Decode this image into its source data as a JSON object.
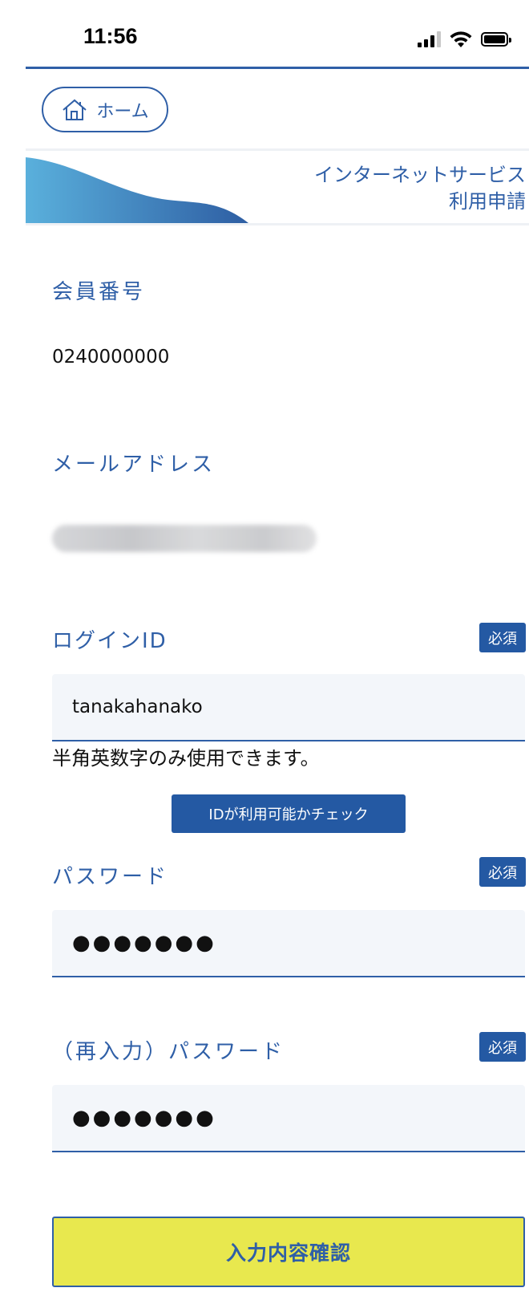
{
  "status_bar": {
    "time": "11:56"
  },
  "nav": {
    "home_label": "ホーム"
  },
  "banner": {
    "title_line1": "インターネットサービス",
    "title_line2": "利用申請"
  },
  "member": {
    "label": "会員番号",
    "value": "0240000000"
  },
  "email": {
    "label": "メールアドレス"
  },
  "login_id": {
    "label": "ログインID",
    "required": "必須",
    "value": "tanakahanako",
    "hint": "半角英数字のみ使用できます。",
    "check_button": "IDが利用可能かチェック"
  },
  "password": {
    "label": "パスワード",
    "required": "必須",
    "value": "●●●●●●●"
  },
  "password_confirm": {
    "label": "（再入力）パスワード",
    "required": "必須",
    "value": "●●●●●●●"
  },
  "submit": {
    "label": "入力内容確認"
  },
  "colors": {
    "primary": "#2f5fa7",
    "badge": "#2459a3",
    "confirm_bg": "#e8e84e",
    "field_bg": "#f3f6fa"
  }
}
